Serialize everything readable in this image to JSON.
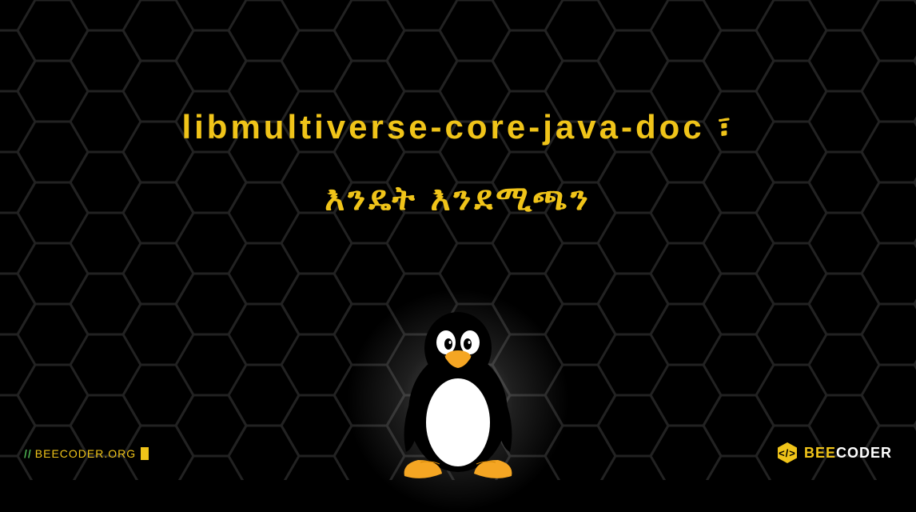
{
  "title": {
    "line1": "libmultiverse-core-java-doc ፣",
    "line2": "እንዴት እንደሚጫን"
  },
  "footer": {
    "url": "BEECODER.ORG",
    "brand_part1": "BEE",
    "brand_part2": "CODER"
  },
  "icons": {
    "penguin": "tux-penguin-icon",
    "brand_hex": "hexagon-icon"
  }
}
